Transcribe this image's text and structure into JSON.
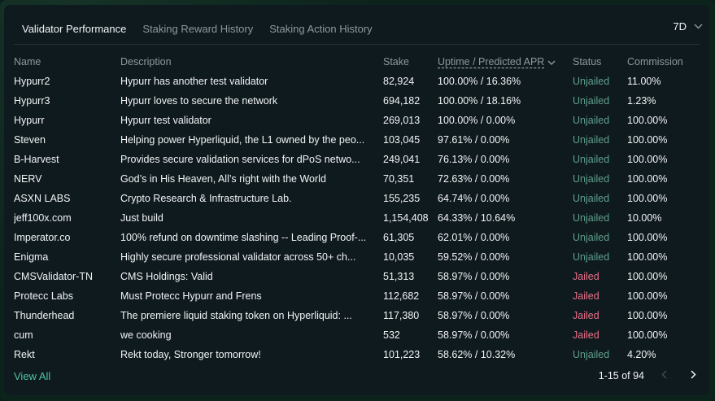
{
  "tabs": [
    {
      "label": "Validator Performance",
      "active": true
    },
    {
      "label": "Staking Reward History",
      "active": false
    },
    {
      "label": "Staking Action History",
      "active": false
    }
  ],
  "period": {
    "value": "7D"
  },
  "table": {
    "headers": {
      "name": "Name",
      "description": "Description",
      "stake": "Stake",
      "uptime_apr": "Uptime / Predicted APR",
      "status": "Status",
      "commission": "Commission"
    },
    "rows": [
      {
        "name": "Hypurr2",
        "description": "Hypurr has another test validator",
        "stake": "82,924",
        "uptime_apr": "100.00% / 16.36%",
        "status": "Unjailed",
        "commission": "11.00%"
      },
      {
        "name": "Hypurr3",
        "description": "Hypurr loves to secure the network",
        "stake": "694,182",
        "uptime_apr": "100.00% / 18.16%",
        "status": "Unjailed",
        "commission": "1.23%"
      },
      {
        "name": "Hypurr",
        "description": "Hypurr test validator",
        "stake": "269,013",
        "uptime_apr": "100.00% / 0.00%",
        "status": "Unjailed",
        "commission": "100.00%"
      },
      {
        "name": "Steven",
        "description": "Helping power Hyperliquid, the L1 owned by the peo...",
        "stake": "103,045",
        "uptime_apr": "97.61% / 0.00%",
        "status": "Unjailed",
        "commission": "100.00%"
      },
      {
        "name": "B-Harvest",
        "description": "Provides secure validation services for dPoS netwo...",
        "stake": "249,041",
        "uptime_apr": "76.13% / 0.00%",
        "status": "Unjailed",
        "commission": "100.00%"
      },
      {
        "name": "NERV",
        "description": "God’s in His Heaven, All’s right with the World",
        "stake": "70,351",
        "uptime_apr": "72.63% / 0.00%",
        "status": "Unjailed",
        "commission": "100.00%"
      },
      {
        "name": "ASXN LABS",
        "description": "Crypto Research & Infrastructure Lab.",
        "stake": "155,235",
        "uptime_apr": "64.74% / 0.00%",
        "status": "Unjailed",
        "commission": "100.00%"
      },
      {
        "name": "jeff100x.com",
        "description": "Just build",
        "stake": "1,154,408",
        "uptime_apr": "64.33% / 10.64%",
        "status": "Unjailed",
        "commission": "10.00%"
      },
      {
        "name": "Imperator.co",
        "description": "100% refund on downtime slashing -- Leading Proof-...",
        "stake": "61,305",
        "uptime_apr": "62.01% / 0.00%",
        "status": "Unjailed",
        "commission": "100.00%"
      },
      {
        "name": "Enigma",
        "description": "Highly secure professional validator across 50+ ch...",
        "stake": "10,035",
        "uptime_apr": "59.52% / 0.00%",
        "status": "Unjailed",
        "commission": "100.00%"
      },
      {
        "name": "CMSValidator-TN",
        "description": "CMS Holdings: Valid",
        "stake": "51,313",
        "uptime_apr": "58.97% / 0.00%",
        "status": "Jailed",
        "commission": "100.00%"
      },
      {
        "name": "Protecc Labs",
        "description": "Must Protecc Hypurr and Frens",
        "stake": "112,682",
        "uptime_apr": "58.97% / 0.00%",
        "status": "Jailed",
        "commission": "100.00%"
      },
      {
        "name": "Thunderhead",
        "description": "The premiere liquid staking token on Hyperliquid: ...",
        "stake": "117,380",
        "uptime_apr": "58.97% / 0.00%",
        "status": "Jailed",
        "commission": "100.00%"
      },
      {
        "name": "cum",
        "description": "we cooking",
        "stake": "532",
        "uptime_apr": "58.97% / 0.00%",
        "status": "Jailed",
        "commission": "100.00%"
      },
      {
        "name": "Rekt",
        "description": "Rekt today, Stronger tomorrow!",
        "stake": "101,223",
        "uptime_apr": "58.62% / 10.32%",
        "status": "Unjailed",
        "commission": "4.20%"
      }
    ]
  },
  "footer": {
    "view_all": "View All",
    "page_info": "1-15 of 94"
  },
  "icons": {
    "period": "chevron-down-icon",
    "sort": "chevron-down-icon",
    "prev": "chevron-left-icon",
    "next": "chevron-right-icon"
  },
  "colors": {
    "accent": "#97fce4",
    "link": "#4ec3a7",
    "unjailed": "#5e9f8c",
    "jailed": "#ed7088"
  }
}
